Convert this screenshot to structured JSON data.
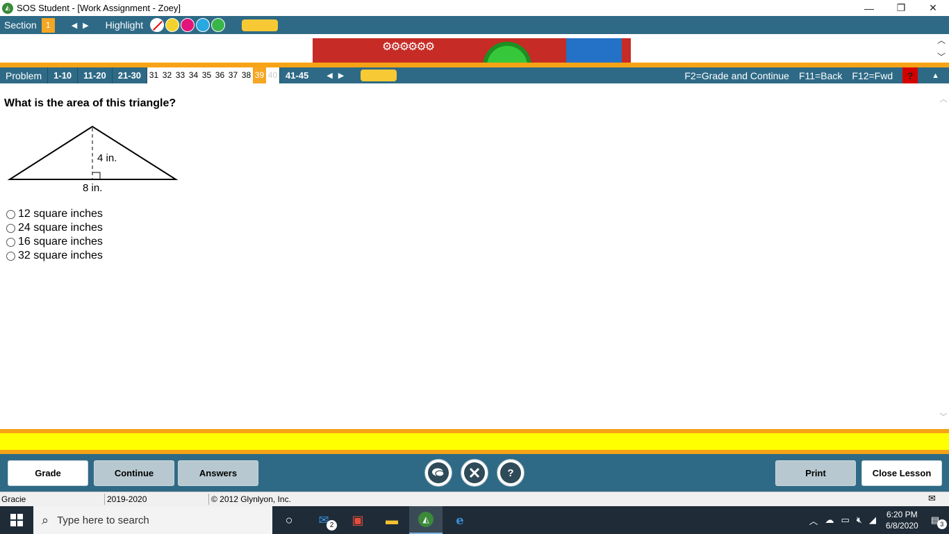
{
  "window": {
    "title": "SOS Student - [Work Assignment - Zoey]",
    "controls": {
      "minimize": "—",
      "restore": "❐",
      "close": "✕"
    }
  },
  "section_bar": {
    "label": "Section",
    "number": "1",
    "prev": "◀",
    "next": "▶",
    "highlight_label": "Highlight",
    "highlight_colors": [
      "#ffffff",
      "#f2d22e",
      "#e1157a",
      "#28a9e1",
      "#3ab54a"
    ]
  },
  "problem_bar": {
    "label": "Problem",
    "ranges_left": [
      "1-10",
      "11-20",
      "21-30"
    ],
    "numbers": [
      "31",
      "32",
      "33",
      "34",
      "35",
      "36",
      "37",
      "38",
      "39",
      "40"
    ],
    "current": "39",
    "range_right": "41-45",
    "prev": "◀",
    "next": "▶",
    "shortcuts": [
      "F2=Grade and Continue",
      "F11=Back",
      "F12=Fwd"
    ],
    "help": "?",
    "collapse": "▲"
  },
  "question": {
    "text": "What is the area of this triangle?",
    "height_label": "4 in.",
    "base_label": "8 in.",
    "choices": [
      "12 square inches",
      "24 square inches",
      "16 square inches",
      "32 square inches"
    ]
  },
  "buttons": {
    "grade": "Grade",
    "continue": "Continue",
    "answers": "Answers",
    "print": "Print",
    "close_lesson": "Close Lesson",
    "tools": [
      "chat-icon",
      "tools-icon",
      "help-icon"
    ],
    "help_glyph": "?"
  },
  "status": {
    "user": "Gracie",
    "year": "2019-2020",
    "copyright": "© 2012 Glynlyon, Inc."
  },
  "taskbar": {
    "search_placeholder": "Type here to search",
    "mail_badge": "2",
    "time": "6:20 PM",
    "date": "6/8/2020",
    "notification_count": "3"
  }
}
